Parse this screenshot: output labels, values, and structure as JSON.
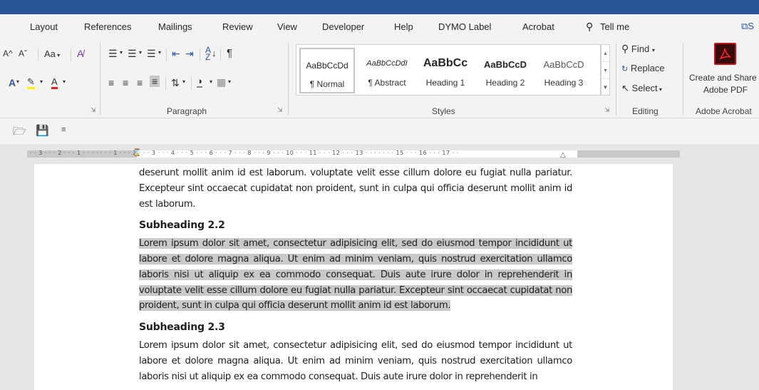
{
  "tabs": [
    "Layout",
    "References",
    "Mailings",
    "Review",
    "View",
    "Developer",
    "Help",
    "DYMO Label",
    "Acrobat"
  ],
  "tell_me": "Tell me",
  "share": "S",
  "font_group": {
    "grow": "A^",
    "shrink": "Aˇ",
    "change_case": "Aa",
    "clear": "A̸",
    "font_color": "A",
    "highlight": "✎",
    "text_color": "A"
  },
  "paragraph_label": "Paragraph",
  "styles": [
    {
      "sample": "AaBbCcDd",
      "name": "¶ Normal"
    },
    {
      "sample": "AaBbCcDdI",
      "name": "¶ Abstract"
    },
    {
      "sample": "AaBbCc",
      "name": "Heading 1"
    },
    {
      "sample": "AaBbCcD",
      "name": "Heading 2"
    },
    {
      "sample": "AaBbCcD",
      "name": "Heading 3"
    }
  ],
  "styles_label": "Styles",
  "editing": {
    "find": "Find",
    "replace": "Replace",
    "select": "Select",
    "label": "Editing"
  },
  "acrobat": {
    "line1": "Create and Share",
    "line2": "Adobe PDF",
    "label": "Adobe Acrobat"
  },
  "ruler_text": "· · 3 · · · 2 · · · 1 · · · · · · · 1 · · · 2 · · · 3 · · · 4 · · · 5 · · · 6 · · · 7 · · · 8 · · · 9 · · · 10 · · · 11 · · · 12 · · · 13 · · · · · · · 15 · · · 16 · · · 17 · ·",
  "document": {
    "para_top": "deserunt mollit anim id est laborum. voluptate velit esse cillum dolore eu fugiat nulla pariatur. Excepteur sint occaecat cupidatat non proident, sunt in culpa qui officia deserunt mollit anim id est laborum.",
    "sub22": "Subheading 2.2",
    "para22": "Lorem ipsum dolor sit amet, consectetur adipisicing elit, sed do eiusmod tempor incididunt ut labore et dolore magna aliqua. Ut enim ad minim veniam, quis nostrud exercitation ullamco laboris nisi ut aliquip ex ea commodo consequat. Duis aute irure dolor in reprehenderit in voluptate velit esse cillum dolore eu fugiat nulla pariatur. Excepteur sint occaecat cupidatat non proident, sunt in culpa qui officia deserunt mollit anim id est laborum.",
    "sub23": "Subheading 2.3",
    "para23": "Lorem ipsum dolor sit amet, consectetur adipisicing elit, sed do eiusmod tempor incididunt ut labore et dolore magna aliqua. Ut enim ad minim veniam, quis nostrud exercitation ullamco laboris nisi ut aliquip ex ea commodo consequat. Duis aute irure dolor in reprehenderit in"
  },
  "colors": {
    "title_bar": "#2b579a",
    "ribbon": "#f3f3f3",
    "highlight": "#c9c9c9"
  }
}
